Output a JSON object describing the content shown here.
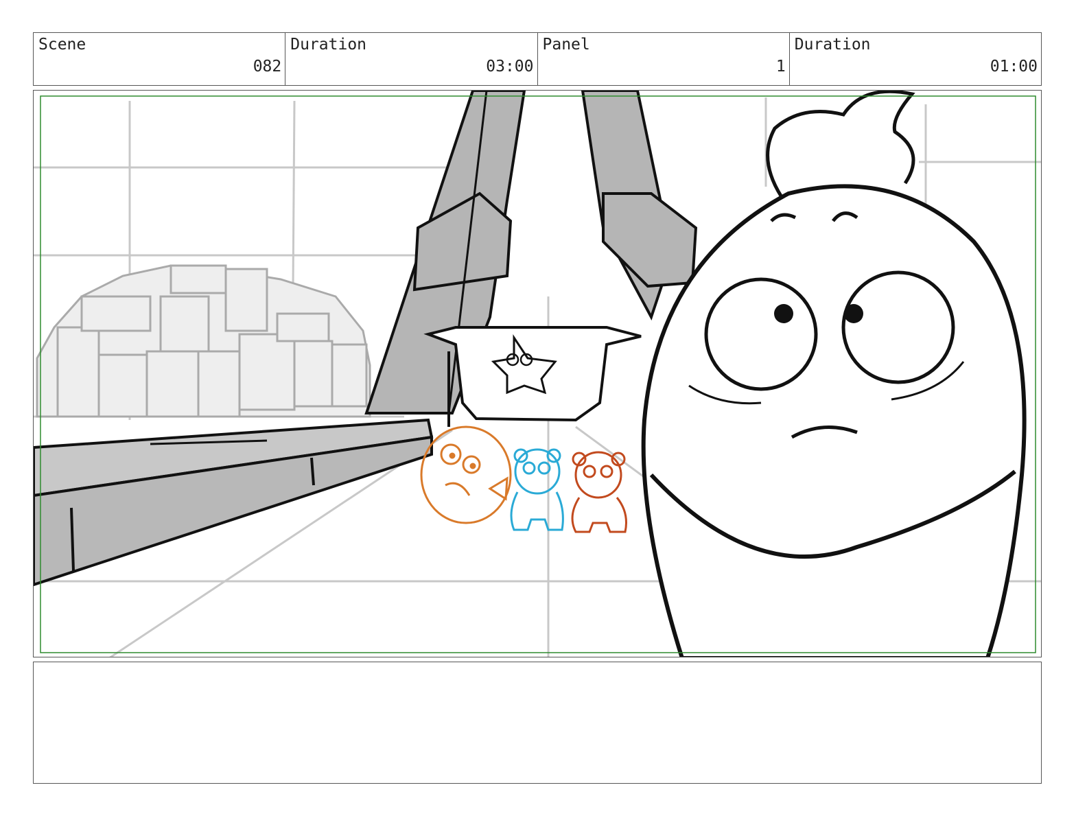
{
  "header": {
    "scene_label": "Scene",
    "scene_value": "082",
    "scene_duration_label": "Duration",
    "scene_duration_value": "03:00",
    "panel_label": "Panel",
    "panel_value": "1",
    "panel_duration_label": "Duration",
    "panel_duration_value": "01:00"
  },
  "notes": {
    "text": ""
  },
  "colors": {
    "frame_guide": "#2e8b2e",
    "fish": "#d97a2a",
    "blue_bear": "#2aaad6",
    "red_bear": "#c24a1e",
    "line": "#111111",
    "grid": "#c8c8c8"
  }
}
